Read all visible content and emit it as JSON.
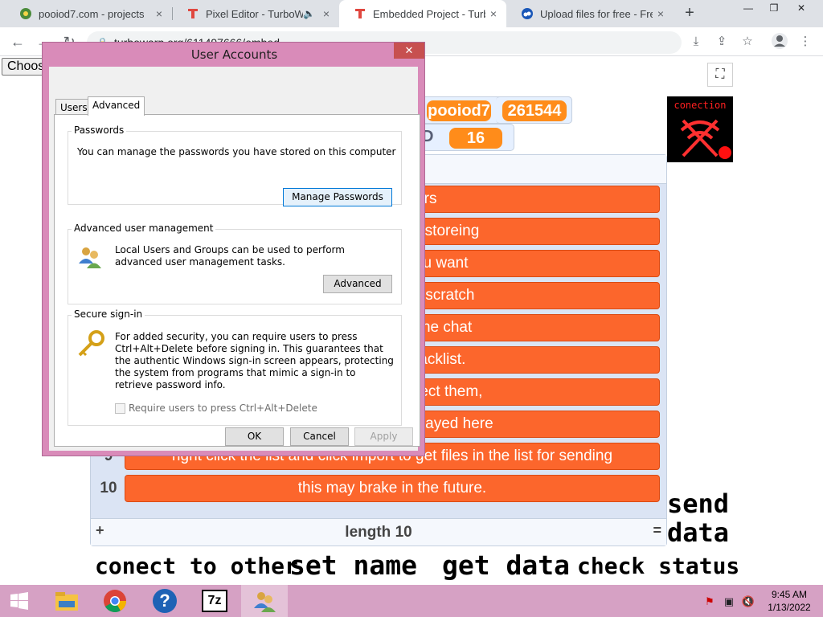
{
  "browser": {
    "tabs": [
      {
        "title": "pooiod7.com - projects",
        "favicon": "globe-icon",
        "close": "×"
      },
      {
        "title": "Pixel Editor - TurboWarp",
        "favicon": "turbowarp-icon",
        "audio": "speaker-icon",
        "close": "×"
      },
      {
        "title": "Embedded Project - TurboWarp",
        "favicon": "turbowarp-icon",
        "close": "×",
        "active": true
      },
      {
        "title": "Upload files for free - Free",
        "favicon": "cloud-icon",
        "close": "×"
      }
    ],
    "new_tab": "+",
    "window_controls": {
      "minimize": "—",
      "restore": "❐",
      "close": "✕"
    },
    "nav": {
      "back": "←",
      "forward": "→",
      "reload": "↻"
    },
    "url": "turbowarp.org/611497666/embed"
  },
  "page": {
    "choose_file_label": "Choose File",
    "fullscreen_icon": "⛶",
    "monitors": {
      "name_value": "pooiod7",
      "id_value": "261544",
      "id_label_partial": "D",
      "count_value": "16"
    },
    "connection_sprite_label": "conection",
    "list": {
      "rows": [
        {
          "index": "",
          "text": "o other users"
        },
        {
          "index": "",
          "text": "or the purpose of storeing"
        },
        {
          "index": "",
          "text": "server. use if you want"
        },
        {
          "index": "",
          "text": "eed to follow the scratch"
        },
        {
          "index": "",
          "text": "made for an online chat"
        },
        {
          "index": "",
          "text": "eed to use a blacklist."
        },
        {
          "index": "",
          "text": "rent names, connect them,"
        },
        {
          "index": "",
          "text": "tabs list will be displayed here"
        },
        {
          "index": "9",
          "text": "right click the list and click import to get files in the list for sending"
        },
        {
          "index": "10",
          "text": "this may brake in the future."
        }
      ],
      "add_label": "+",
      "length_label": "length 10",
      "resize_label": "="
    },
    "sprite_buttons": {
      "send": "send",
      "data": "data",
      "connect": "conect to other",
      "set_name": "set name",
      "get_data": "get data",
      "check_status": "check status"
    }
  },
  "dialog": {
    "title": "User Accounts",
    "close": "✕",
    "tabs": [
      {
        "label": "Users"
      },
      {
        "label": "Advanced",
        "active": true
      }
    ],
    "passwords": {
      "title": "Passwords",
      "text": "You can manage the passwords you have stored on this computer",
      "button": "Manage Passwords"
    },
    "advanced_mgmt": {
      "title": "Advanced user management",
      "text": "Local Users and Groups can be used to perform advanced user management tasks.",
      "button": "Advanced"
    },
    "secure_signin": {
      "title": "Secure sign-in",
      "text": "For added security, you can require users to press Ctrl+Alt+Delete before signing in. This guarantees that the authentic Windows sign-in screen appears, protecting the system from programs that mimic a sign-in to retrieve password info.",
      "checkbox": "Require users to press Ctrl+Alt+Delete"
    },
    "buttons": {
      "ok": "OK",
      "cancel": "Cancel",
      "apply": "Apply"
    }
  },
  "taskbar": {
    "clock_time": "9:45 AM",
    "clock_date": "1/13/2022",
    "apps": [
      "start-icon",
      "file-explorer-icon",
      "chrome-icon",
      "help-icon",
      "7zip-icon",
      "user-accounts-icon"
    ],
    "help_glyph": "?",
    "sevenzip_label": "7z"
  },
  "colors": {
    "accent_orange": "#ff8c1a",
    "list_item": "#fc662c",
    "dialog_frame": "#d98bb9",
    "taskbar": "#d6a1c4"
  }
}
